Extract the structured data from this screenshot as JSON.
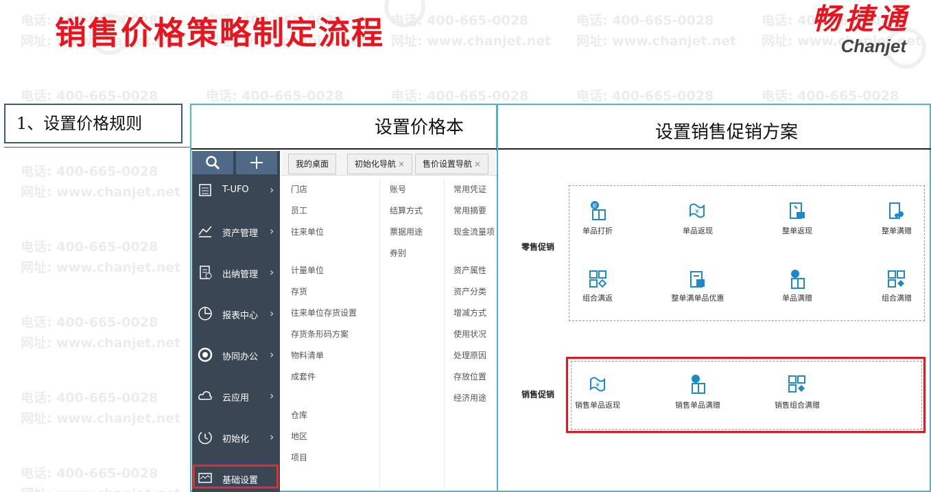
{
  "header": {
    "title": "销售价格策略制定流程",
    "logo_cn": "畅捷通",
    "logo_en": "Chanjet"
  },
  "watermark": {
    "phone": "电话: 400-665-0028",
    "site": "网址: www.chanjet.net"
  },
  "step": {
    "label": "1、设置价格规则"
  },
  "panels": {
    "price_title": "设置价格本",
    "promo_title": "设置销售促销方案"
  },
  "sidebar": {
    "search_icon": "search-icon",
    "add_icon": "plus-icon",
    "items": [
      {
        "label": "T-UFO",
        "icon": "tufo-icon"
      },
      {
        "label": "资产管理",
        "icon": "asset-icon"
      },
      {
        "label": "出纳管理",
        "icon": "cashier-icon"
      },
      {
        "label": "报表中心",
        "icon": "report-icon"
      },
      {
        "label": "协同办公",
        "icon": "collab-icon"
      },
      {
        "label": "云应用",
        "icon": "cloud-icon"
      },
      {
        "label": "初始化",
        "icon": "init-icon"
      },
      {
        "label": "基础设置",
        "icon": "settings-icon"
      }
    ],
    "arrow": "›"
  },
  "tabs": [
    {
      "label": "我的桌面",
      "close": ""
    },
    {
      "label": "初始化导航",
      "close": "×"
    },
    {
      "label": "售价设置导航",
      "close": "×"
    }
  ],
  "menu": {
    "col1": [
      "门店",
      "员工",
      "往来单位",
      "计量单位",
      "存货",
      "往来单位存货设置",
      "存货条形码方案",
      "物料清单",
      "成套件",
      "仓库",
      "地区",
      "项目"
    ],
    "col2": [
      "账号",
      "结算方式",
      "票据用途",
      "券别"
    ],
    "col3": [
      "常用凭证",
      "常用摘要",
      "现金流量项",
      "资产属性",
      "资产分类",
      "增减方式",
      "使用状况",
      "处理原因",
      "存放位置",
      "经济用途"
    ]
  },
  "promo": {
    "retail_label": "零售促销",
    "sales_label": "销售促销",
    "retail_items": [
      "单品打折",
      "单品返现",
      "整单返现",
      "整单满赠",
      "组合满返",
      "整单满单品优惠",
      "单品满赠",
      "组合满赠"
    ],
    "sales_items": [
      "销售单品返现",
      "销售单品满赠",
      "销售组合满赠"
    ]
  },
  "colors": {
    "title_red": "#e8141e",
    "panel_border": "#4db6c6",
    "sidebar_bg": "#3a4654",
    "icon_blue": "#1e88c8"
  }
}
